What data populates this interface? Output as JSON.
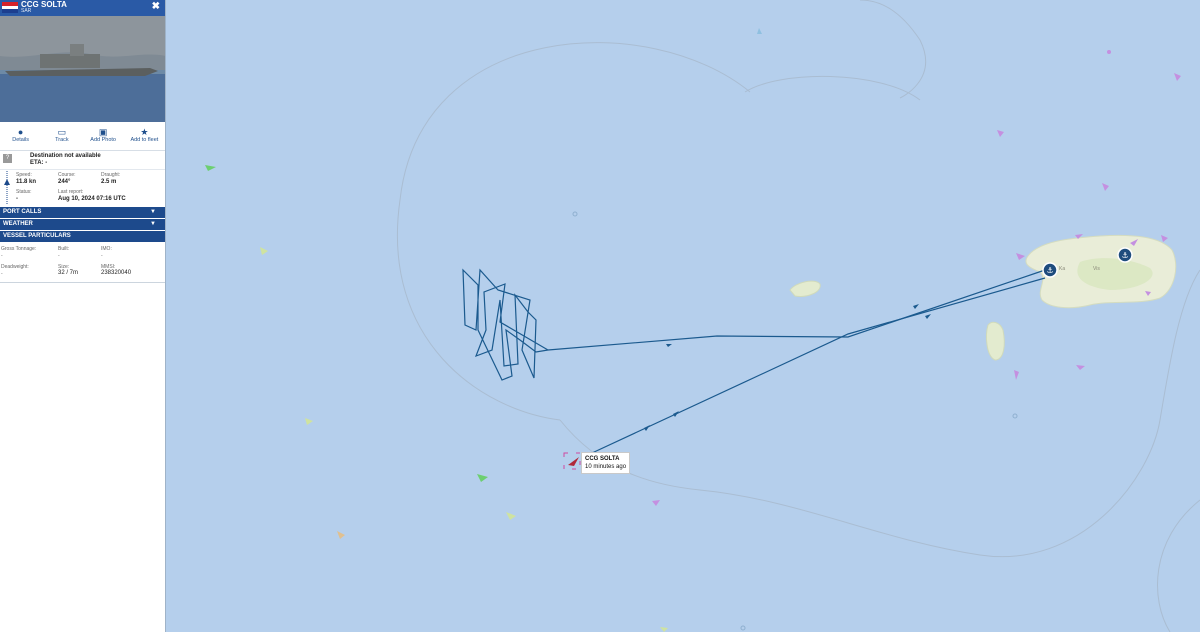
{
  "vessel": {
    "name": "CCG SOLTA",
    "type": "SAR",
    "close_icon": "close-icon",
    "flag_colors": [
      "#d6232a",
      "#ffffff",
      "#1d3f8f"
    ]
  },
  "actions": [
    {
      "label": "Details",
      "icon": "info-icon"
    },
    {
      "label": "Track",
      "icon": "track-icon"
    },
    {
      "label": "Add Photo",
      "icon": "camera-icon"
    },
    {
      "label": "Add to fleet",
      "icon": "star-icon"
    }
  ],
  "voyage": {
    "destination_text": "Destination not available",
    "eta_text": "ETA: -",
    "badge": "?"
  },
  "stats": {
    "speed_label": "Speed:",
    "speed_value": "11.8 kn",
    "course_label": "Course:",
    "course_value": "244°",
    "draught_label": "Draught:",
    "draught_value": "2.5 m",
    "status_label": "Status:",
    "status_value": "-",
    "last_report_label": "Last report:",
    "last_report_value": "Aug 10, 2024 07:16 UTC"
  },
  "sections": {
    "port_calls": "PORT CALLS",
    "weather": "WEATHER",
    "vessel_particulars": "VESSEL PARTICULARS"
  },
  "particulars": {
    "gross_tonnage_label": "Gross Tonnage:",
    "gross_tonnage_value": "-",
    "built_label": "Built:",
    "built_value": "-",
    "imo_label": "IMO:",
    "imo_value": "-",
    "deadweight_label": "Deadweight:",
    "deadweight_value": "-",
    "size_label": "Size:",
    "size_value": "32 / 7m",
    "mmsi_label": "MMSI:",
    "mmsi_value": "238320040"
  },
  "map": {
    "vessel_label_name": "CCG SOLTA",
    "vessel_label_time": "10 minutes ago",
    "place_label_1": "Ka",
    "place_label_2": "Vis",
    "water_color": "#b5cfec",
    "land_color": "#eef0e4",
    "track_color": "#1b5a8e"
  }
}
